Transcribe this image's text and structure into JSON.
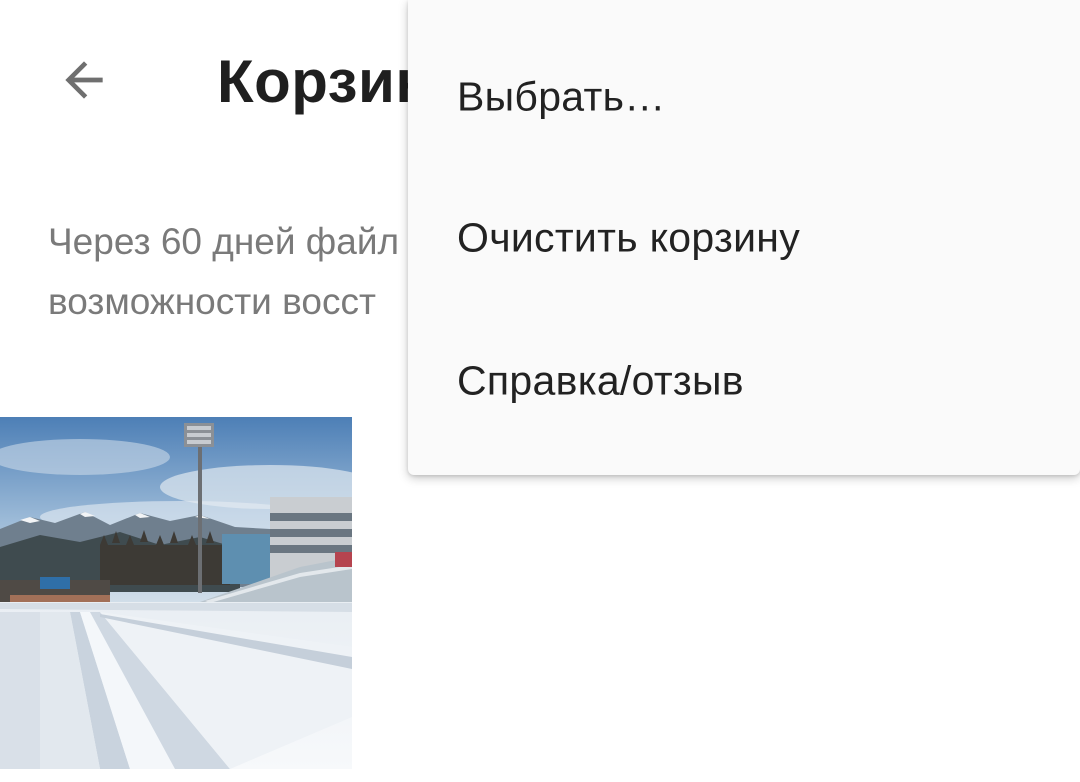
{
  "header": {
    "back_icon": "arrow-left-icon",
    "title": "Корзин"
  },
  "notice": {
    "line1": "Через 60 дней файл",
    "line2": "возможности восст"
  },
  "trash": {
    "items": [
      {
        "type": "photo",
        "subject": "snowy ski track with stadium and mountains"
      }
    ]
  },
  "overflow_menu": {
    "items": [
      {
        "label": "Выбрать…"
      },
      {
        "label": "Очистить корзину"
      },
      {
        "label": "Справка/отзыв"
      }
    ]
  },
  "colors": {
    "title": "#1f1f1f",
    "secondary_text": "#7a7a7a",
    "menu_background": "#fafafa",
    "menu_text": "#222222",
    "icon": "#6f6f6f"
  }
}
